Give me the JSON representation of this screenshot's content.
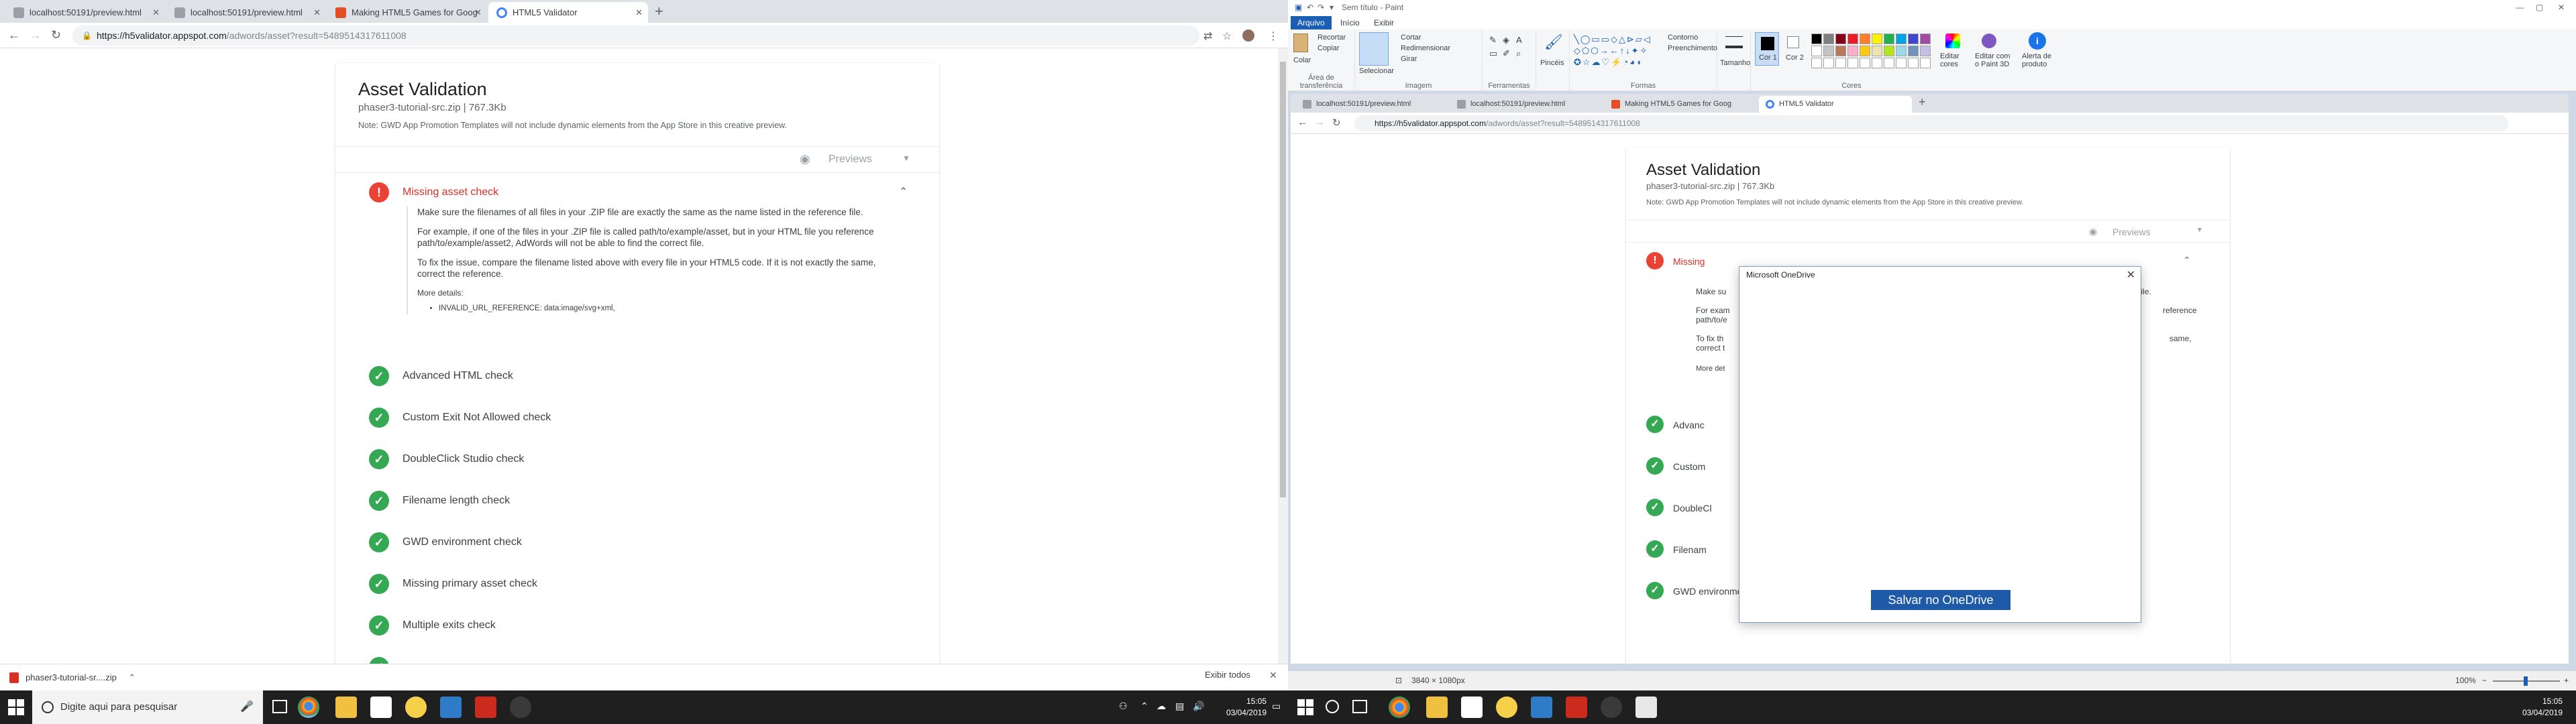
{
  "left": {
    "tabs": [
      {
        "title": "localhost:50191/preview.html",
        "icon_color": "#9aa0a6"
      },
      {
        "title": "localhost:50191/preview.html",
        "icon_color": "#9aa0a6"
      },
      {
        "title": "Making HTML5 Games for Goog",
        "icon_color": "#e44d26"
      },
      {
        "title": "HTML5 Validator",
        "icon_color": "#4285f4"
      }
    ],
    "new_tab": "+",
    "url_host": "https://h5validator.appspot.com",
    "url_path": "/adwords/asset?result=5489514317611008",
    "page": {
      "title": "Asset Validation",
      "subtitle": "phaser3-tutorial-src.zip | 767.3Kb",
      "note": "Note: GWD App Promotion Templates will not include dynamic elements from the App Store in this creative preview.",
      "previews_label": "Previews",
      "error_check": {
        "label": "Missing asset check",
        "p1": "Make sure the filenames of all files in your .ZIP file are exactly the same as the name listed in the reference file.",
        "p2": "For example, if one of the files in your .ZIP file is called path/to/example/asset, but in your HTML file you reference path/to/example/asset2, AdWords will not be able to find the correct file.",
        "p3": "To fix the issue, compare the filename listed above with every file in your HTML5 code. If it is not exactly the same, correct the reference.",
        "more_details": "More details:",
        "bullet": "INVALID_URL_REFERENCE: data:image/svg+xml,"
      },
      "checks": [
        "Advanced HTML check",
        "Custom Exit Not Allowed check",
        "DoubleClick Studio check",
        "Filename length check",
        "GWD environment check",
        "Missing primary asset check",
        "Multiple exits check"
      ]
    },
    "downloads": {
      "file": "phaser3-tutorial-sr....zip",
      "show_all": "Exibir todos"
    }
  },
  "paint": {
    "title": "Sem título - Paint",
    "ribbon_tabs": [
      "Arquivo",
      "Início",
      "Exibir"
    ],
    "groups": {
      "clipboard": {
        "paste": "Colar",
        "cut": "Recortar",
        "copy": "Copiar",
        "name": "Área de transferência"
      },
      "image": {
        "select": "Selecionar",
        "crop": "Cortar",
        "resize": "Redimensionar",
        "rotate": "Girar",
        "name": "Imagem"
      },
      "tools": {
        "name": "Ferramentas"
      },
      "brushes": {
        "label": "Pincéis"
      },
      "shapes": {
        "outline": "Contorno",
        "fill": "Preenchimento",
        "name": "Formas"
      },
      "size": {
        "label": "Tamanho"
      },
      "colors": {
        "color1": "Cor 1",
        "color2": "Cor 2",
        "edit": "Editar cores",
        "paint3d": "Editar com o Paint 3D",
        "alert": "Alerta de produto",
        "name": "Cores"
      }
    },
    "palette": [
      "#000000",
      "#7f7f7f",
      "#880015",
      "#ed1c24",
      "#ff7f27",
      "#fff200",
      "#22b14c",
      "#00a2e8",
      "#3f48cc",
      "#a349a4",
      "#ffffff",
      "#c3c3c3",
      "#b97a57",
      "#ffaec9",
      "#ffc90e",
      "#efe4b0",
      "#b5e61d",
      "#99d9ea",
      "#7092be",
      "#c8bfe7"
    ],
    "status": {
      "dimensions": "3840 × 1080px",
      "zoom": "100%"
    },
    "inner": {
      "tabs": [
        "localhost:50191/preview.html",
        "localhost:50191/preview.html",
        "Making HTML5 Games for Goog",
        "HTML5 Validator"
      ],
      "url_host": "https://h5validator.appspot.com",
      "url_path": "/adwords/asset?result=5489514317611008",
      "title": "Asset Validation",
      "subtitle": "phaser3-tutorial-src.zip | 767.3Kb",
      "note": "Note: GWD App Promotion Templates will not include dynamic elements from the App Store in this creative preview.",
      "previews_label": "Previews",
      "error_label_partial": "Missing",
      "p1_partial": "Make su",
      "p1_end": "e reference file.",
      "p2_partial": "For exam",
      "p2_end": "reference",
      "p2b_partial": "path/to/e",
      "p3_partial": "To fix th",
      "p3_end": "same,",
      "p3b_partial": "correct t",
      "more_partial": "More det",
      "checks_partial": [
        "Advanc",
        "Custom",
        "DoubleCl",
        "Filenam"
      ],
      "last_check": "GWD environment check"
    },
    "dialog": {
      "title": "Microsoft OneDrive",
      "button": "Salvar no OneDrive"
    }
  },
  "taskbar": {
    "search_placeholder": "Digite aqui para pesquisar",
    "time": "15:05",
    "date": "03/04/2019"
  }
}
